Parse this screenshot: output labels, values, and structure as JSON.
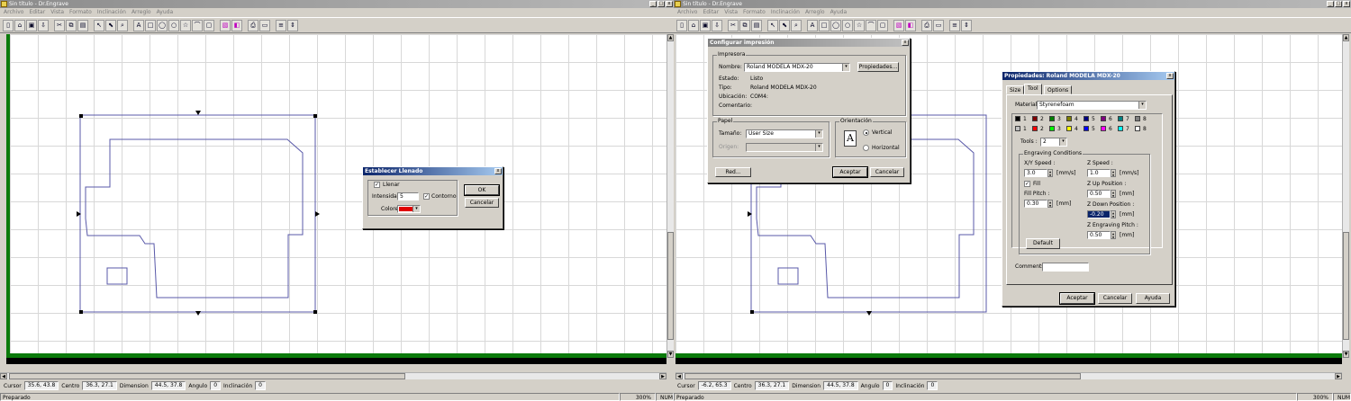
{
  "left": {
    "title": "Sin título - Dr.Engrave",
    "menu": [
      "Archivo",
      "Editar",
      "Vista",
      "Formato",
      "Inclinación",
      "Arreglo",
      "Ayuda"
    ],
    "status": {
      "cursor_label": "Cursor",
      "cursor": "35.6, 43.8",
      "centro_label": "Centro",
      "centro": "36.3, 27.1",
      "dimension_label": "Dimension",
      "dimension": "44.5, 37.8",
      "angulo_label": "Angulo",
      "angulo": "0",
      "inclinacion_label": "Inclinación",
      "inclinacion": "0"
    },
    "message": "Preparado",
    "zoom": "300%",
    "num": "NUM",
    "fill_dialog": {
      "title": "Establecer Llenado",
      "llenar_label": "Llenar",
      "llenar_checked": true,
      "intensidad_label": "Intensidad",
      "intensidad_value": "5",
      "contorno_label": "Contorno",
      "contorno_checked": true,
      "colores_label": "Colores",
      "color_value": "#e00000",
      "ok_label": "OK",
      "cancel_label": "Cancelar"
    }
  },
  "right": {
    "title": "Sin título - Dr.Engrave",
    "menu": [
      "Archivo",
      "Editar",
      "Vista",
      "Formato",
      "Inclinación",
      "Arreglo",
      "Ayuda"
    ],
    "status": {
      "cursor_label": "Cursor",
      "cursor": "-6.2, 65.3",
      "centro_label": "Centro",
      "centro": "36.3, 27.1",
      "dimension_label": "Dimension",
      "dimension": "44.5, 37.8",
      "angulo_label": "Angulo",
      "angulo": "0",
      "inclinacion_label": "Inclinación",
      "inclinacion": "0"
    },
    "message": "Preparado",
    "zoom": "300%",
    "num": "NUM",
    "print_dialog": {
      "title": "Configurar impresión",
      "impresora_group": "Impresora",
      "nombre_label": "Nombre:",
      "nombre_value": "Roland MODELA MDX-20",
      "propiedades_label": "Propiedades...",
      "estado_label": "Estado:",
      "estado_value": "Listo",
      "tipo_label": "Tipo:",
      "tipo_value": "Roland MODELA MDX-20",
      "ubicacion_label": "Ubicación:",
      "ubicacion_value": "COM4:",
      "comentario_label": "Comentario:",
      "papel_group": "Papel",
      "tamano_label": "Tamaño:",
      "tamano_value": "User Size",
      "origen_label": "Origen:",
      "orientacion_group": "Orientación",
      "vertical_label": "Vertical",
      "horizontal_label": "Horizontal",
      "orientation_selected": "Vertical",
      "red_label": "Red...",
      "aceptar_label": "Aceptar",
      "cancelar_label": "Cancelar"
    },
    "props_dialog": {
      "title": "Propiedades: Roland MODELA MDX-20",
      "tabs": [
        "Size",
        "Tool",
        "Options"
      ],
      "selected_tab": "Tool",
      "material_label": "Material",
      "material_value": "Styrenefoam",
      "tool_row1": [
        {
          "n": "1",
          "color": "#000000"
        },
        {
          "n": "2",
          "color": "#800000"
        },
        {
          "n": "3",
          "color": "#008000"
        },
        {
          "n": "4",
          "color": "#808000"
        },
        {
          "n": "5",
          "color": "#000080"
        },
        {
          "n": "6",
          "color": "#800080"
        },
        {
          "n": "7",
          "color": "#008080"
        },
        {
          "n": "8",
          "color": "#808080"
        }
      ],
      "tool_row2": [
        {
          "n": "1",
          "color": "#c0c0c0"
        },
        {
          "n": "2",
          "color": "#ff0000"
        },
        {
          "n": "3",
          "color": "#00ff00"
        },
        {
          "n": "4",
          "color": "#ffff00"
        },
        {
          "n": "5",
          "color": "#0000ff"
        },
        {
          "n": "6",
          "color": "#ff00ff"
        },
        {
          "n": "7",
          "color": "#00ffff"
        },
        {
          "n": "8",
          "color": "#ffffff"
        }
      ],
      "tools_label": "Tools :",
      "tools_value": "2",
      "engraving_group": "Engraving Conditions",
      "xy_speed_label": "X/Y Speed :",
      "xy_speed_value": "3.0",
      "xy_speed_unit": "[mm/s]",
      "z_speed_label": "Z Speed :",
      "z_speed_value": "1.0",
      "z_speed_unit": "[mm/s]",
      "fill_label": "Fill",
      "fill_checked": true,
      "fill_pitch_label": "Fill Pitch :",
      "fill_pitch_value": "0.30",
      "fill_pitch_unit": "[mm]",
      "z_up_label": "Z Up Position :",
      "z_up_value": "0.50",
      "z_up_unit": "[mm]",
      "z_down_label": "Z Down Position :",
      "z_down_value": "-0.20",
      "z_down_unit": "[mm]",
      "z_engr_pitch_label": "Z Engraving Pitch :",
      "z_engr_pitch_value": "0.50",
      "z_engr_pitch_unit": "[mm]",
      "default_label": "Default",
      "comments_label": "Comments",
      "aceptar_label": "Aceptar",
      "cancelar_label": "Cancelar",
      "ayuda_label": "Ayuda"
    }
  },
  "toolbar_icons": [
    "new-icon",
    "open-icon",
    "save-icon",
    "import-icon",
    "cut-icon",
    "copy-icon",
    "paste-icon",
    "pointer-icon",
    "node-edit-icon",
    "zoom-icon",
    "text-icon",
    "rectangle-icon",
    "ellipse-icon",
    "circle-icon",
    "star-icon",
    "polyline-icon",
    "image-icon",
    "fill-icon",
    "color-icon",
    "print-icon",
    "print-setup-icon",
    "font-icon",
    "spacing-icon"
  ]
}
